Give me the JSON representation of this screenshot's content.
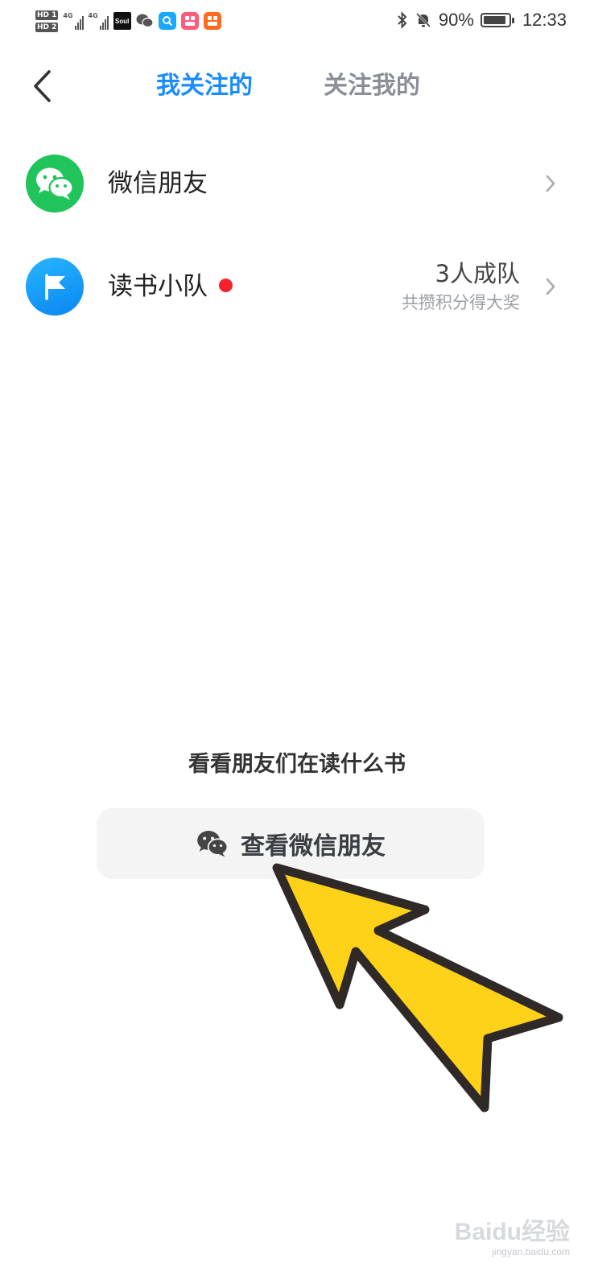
{
  "status_bar": {
    "sim1": "HD 1",
    "sim2": "HD 2",
    "network1": "4G",
    "network2": "4G",
    "app_soul": "Soul",
    "battery_percent": "90%",
    "battery_level": 0.9,
    "time": "12:33"
  },
  "header": {
    "back_icon": "chevron-left-icon",
    "tabs": [
      {
        "label": "我关注的",
        "active": true
      },
      {
        "label": "关注我的",
        "active": false
      }
    ]
  },
  "list": {
    "wechat": {
      "title": "微信朋友",
      "icon": "wechat-icon",
      "color": "#21c35b"
    },
    "team": {
      "title": "读书小队",
      "icon": "flag-icon",
      "right_main": "3人成队",
      "right_sub": "共攒积分得大奖",
      "dot_color": "#f5222d"
    }
  },
  "bottom": {
    "prompt": "看看朋友们在读什么书",
    "button_label": "查看微信朋友",
    "button_icon": "wechat-icon"
  },
  "watermark": {
    "main": "Baidu经验",
    "sub": "jingyan.baidu.com"
  },
  "colors": {
    "accent": "#1a8cff",
    "annotation_arrow": "#ffd21a"
  }
}
